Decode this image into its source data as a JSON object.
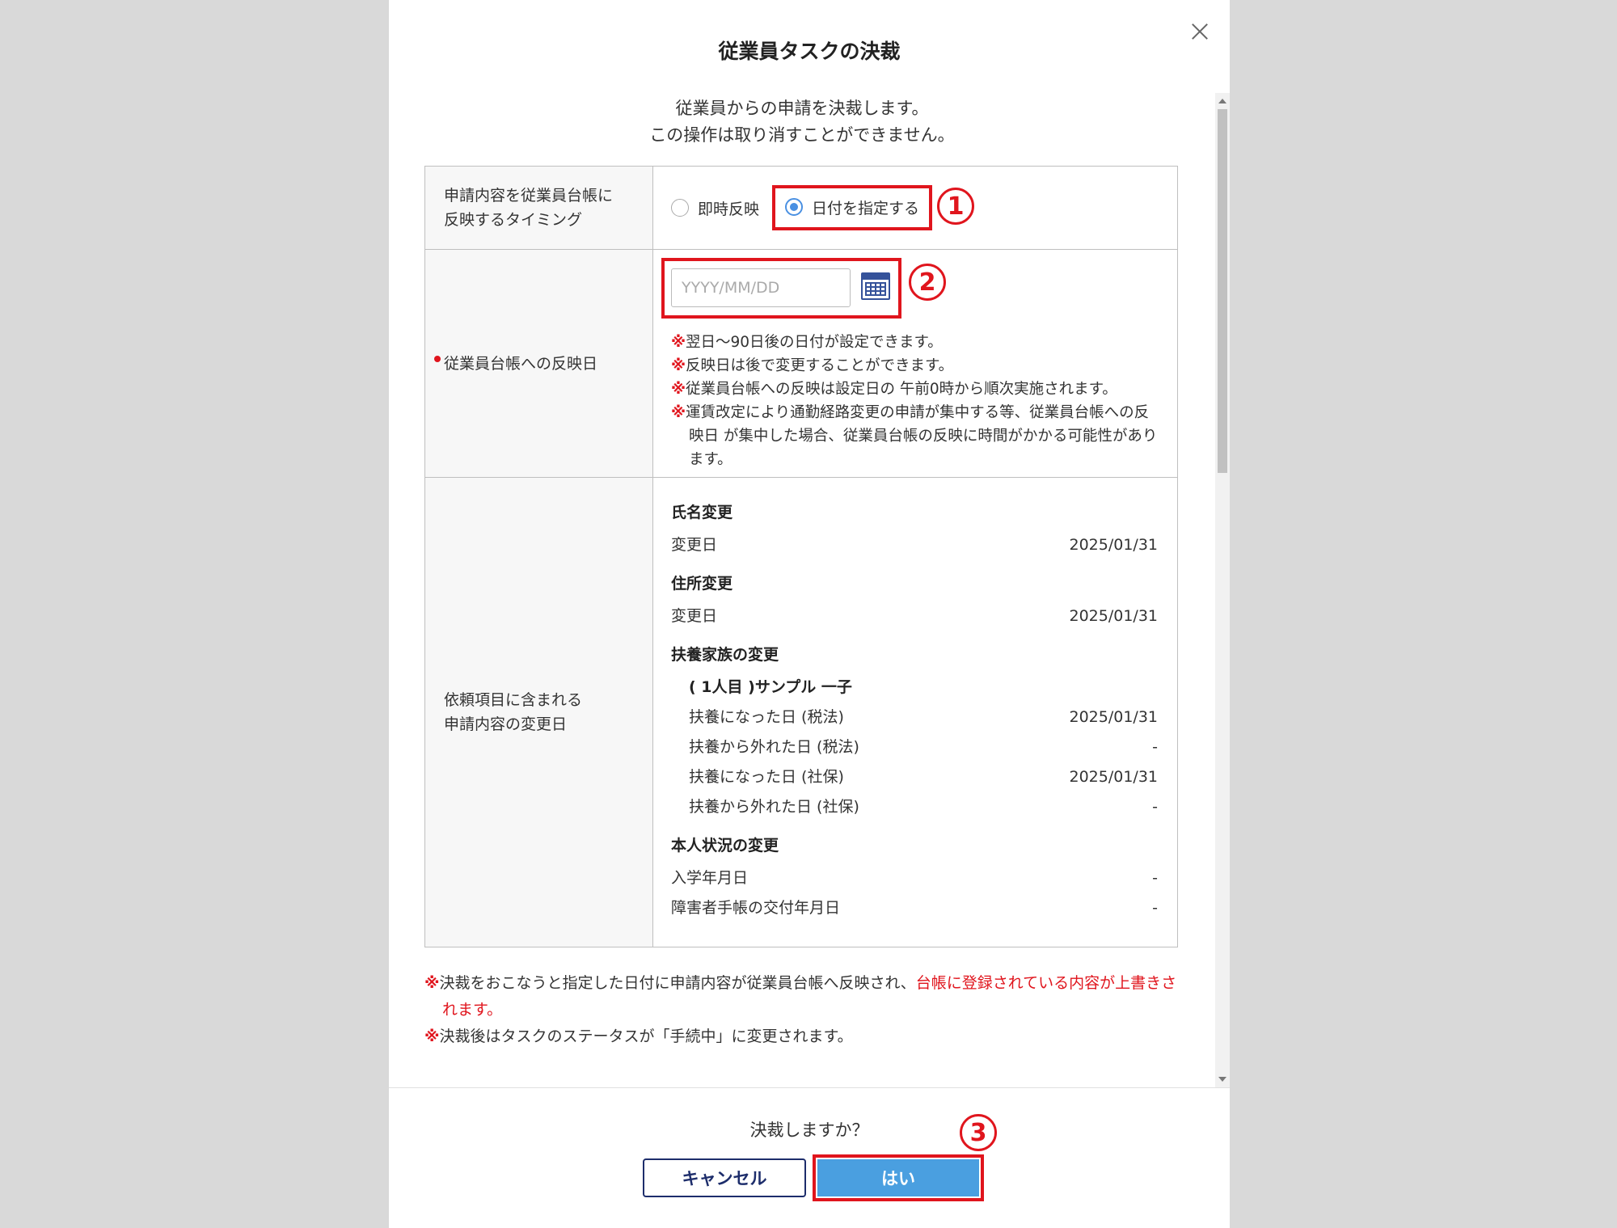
{
  "dialog": {
    "title": "従業員タスクの決裁",
    "intro_line1": "従業員からの申請を決裁します。",
    "intro_line2": "この操作は取り消すことができません。"
  },
  "timing_row": {
    "label_line1": "申請内容を従業員台帳に",
    "label_line2": "反映するタイミング",
    "option_immediate": "即時反映",
    "option_specify": "日付を指定する",
    "selected": "日付を指定する"
  },
  "date_row": {
    "label": "従業員台帳への反映日",
    "placeholder": "YYYY/MM/DD",
    "notes_mark": "※",
    "notes": [
      "翌日〜90日後の日付が設定できます。",
      "反映日は後で変更することができます。",
      "従業員台帳への反映は設定日の 午前0時から順次実施されます。",
      "運賃改定により通勤経路変更の申請が集中する等、従業員台帳への反映日 が集中した場合、従業員台帳の反映に時間がかかる可能性があります。"
    ]
  },
  "changes_row": {
    "label_line1": "依頼項目に含まれる",
    "label_line2": "申請内容の変更日",
    "name_change": {
      "title": "氏名変更",
      "key": "変更日",
      "value": "2025/01/31"
    },
    "address_change": {
      "title": "住所変更",
      "key": "変更日",
      "value": "2025/01/31"
    },
    "dependents_change": {
      "title": "扶養家族の変更",
      "person": "( 1人目 )サンプル 一子",
      "items": [
        {
          "key": "扶養になった日 (税法)",
          "value": "2025/01/31"
        },
        {
          "key": "扶養から外れた日 (税法)",
          "value": "-"
        },
        {
          "key": "扶養になった日 (社保)",
          "value": "2025/01/31"
        },
        {
          "key": "扶養から外れた日 (社保)",
          "value": "-"
        }
      ]
    },
    "status_change": {
      "title": "本人状況の変更",
      "items": [
        {
          "key": "入学年月日",
          "value": "-"
        },
        {
          "key": "障害者手帳の交付年月日",
          "value": "-"
        }
      ]
    }
  },
  "bottom_notes": {
    "mark": "※",
    "note1_normal": "決裁をおこなうと指定した日付に申請内容が従業員台帳へ反映され、",
    "note1_red": "台帳に登録されている内容が上書きされます。",
    "note2": "決裁後はタスクのステータスが「手続中」に変更されます。"
  },
  "footer": {
    "question": "決裁しますか？",
    "cancel_label": "キャンセル",
    "yes_label": "はい"
  },
  "annotations": {
    "step1": "1",
    "step2": "2",
    "step3": "3"
  },
  "colors": {
    "accent_blue": "#4a9fe0",
    "highlight_red": "#e0151d",
    "navy": "#1d2d6b"
  },
  "icons": [
    "close-icon",
    "calendar-icon"
  ]
}
